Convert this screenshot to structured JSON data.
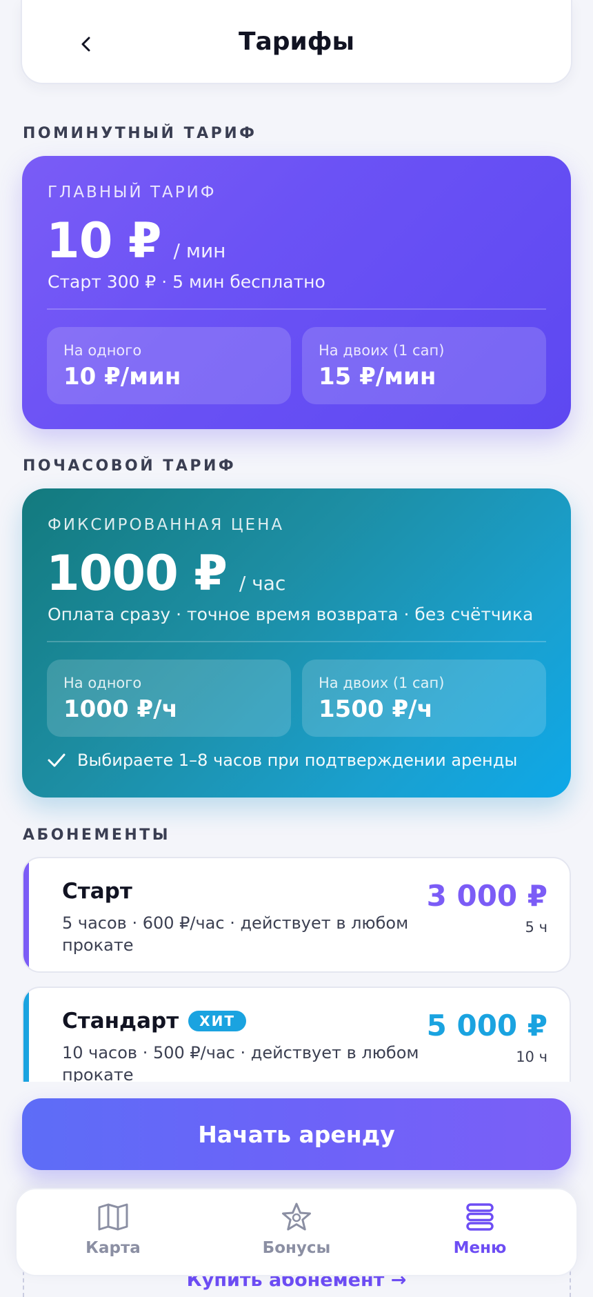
{
  "header": {
    "title": "Тарифы"
  },
  "minute_section": {
    "title": "ПОМИНУТНЫЙ ТАРИФ",
    "card": {
      "label": "ГЛАВНЫЙ ТАРИФ",
      "price": "10 ₽",
      "unit": "/ мин",
      "desc": "Старт 300 ₽ · 5 мин бесплатно",
      "options": [
        {
          "label": "На одного",
          "value": "10 ₽/мин"
        },
        {
          "label": "На двоих (1 сап)",
          "value": "15 ₽/мин"
        }
      ]
    }
  },
  "hour_section": {
    "title": "ПОЧАСОВОЙ ТАРИФ",
    "card": {
      "label": "ФИКСИРОВАННАЯ ЦЕНА",
      "price": "1000 ₽",
      "unit": "/ час",
      "desc": "Оплата сразу · точное время возврата · без счётчика",
      "options": [
        {
          "label": "На одного",
          "value": "1000 ₽/ч"
        },
        {
          "label": "На двоих (1 сап)",
          "value": "1500 ₽/ч"
        }
      ],
      "note": "Выбираете 1–8 часов при подтверждении аренды"
    }
  },
  "subscriptions": {
    "title": "АБОНЕМЕНТЫ",
    "items": [
      {
        "name": "Старт",
        "badge": "",
        "desc": "5 часов · 600 ₽/час · действует в любом прокате",
        "price": "3 000 ₽",
        "hours": "5 ч",
        "color": "#7b5cf6"
      },
      {
        "name": "Стандарт",
        "badge": "ХИТ",
        "desc": "10 часов · 500 ₽/час · действует в любом прокате",
        "price": "5 000 ₽",
        "hours": "10 ч",
        "color": "#1aa3e0"
      }
    ],
    "buy_link": "Купить абонемент →"
  },
  "cta": {
    "label": "Начать аренду"
  },
  "nav": {
    "items": [
      {
        "label": "Карта",
        "icon": "map-icon",
        "active": false
      },
      {
        "label": "Бонусы",
        "icon": "star-icon",
        "active": false
      },
      {
        "label": "Меню",
        "icon": "menu-icon",
        "active": true
      }
    ]
  },
  "colors": {
    "accent": "#6d4df4",
    "minute_card": "#6b52f5",
    "hour_card": "#1aa0cf"
  }
}
